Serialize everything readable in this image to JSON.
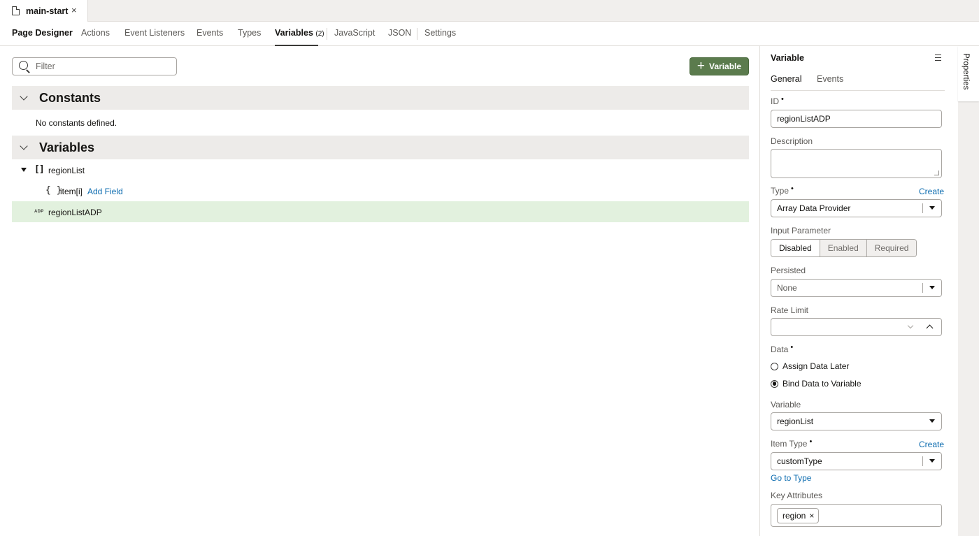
{
  "file_tab": {
    "name": "main-start",
    "close": "×",
    "icon": "document-icon"
  },
  "tabs": [
    {
      "label": "Page Designer"
    },
    {
      "label": "Actions"
    },
    {
      "label": "Event Listeners"
    },
    {
      "label": "Events"
    },
    {
      "label": "Types"
    },
    {
      "label": "Variables",
      "count": "(2)",
      "active": true
    },
    {
      "label": "JavaScript"
    },
    {
      "label": "JSON"
    },
    {
      "label": "Settings"
    }
  ],
  "toolbar": {
    "filter_placeholder": "Filter",
    "add_variable_label": "Variable",
    "add_icon": "+"
  },
  "constants": {
    "title": "Constants",
    "empty_text": "No constants defined."
  },
  "variables": {
    "title": "Variables",
    "items": [
      {
        "icon_text": "[]",
        "name": "regionList",
        "expanded": true
      },
      {
        "icon_text": "{ }",
        "name": "item[i]",
        "action": "Add Field"
      },
      {
        "icon_text": "ADP",
        "name": "regionListADP",
        "selected": true
      }
    ]
  },
  "properties_tab_label": "Properties",
  "panel": {
    "title": "Variable",
    "tabs": [
      "General",
      "Events"
    ],
    "active_tab": "General",
    "id_label": "ID",
    "id_value": "regionListADP",
    "description_label": "Description",
    "description_value": "",
    "type_label": "Type",
    "type_create": "Create",
    "type_value": "Array Data Provider",
    "input_parameter_label": "Input Parameter",
    "input_parameter_options": [
      "Disabled",
      "Enabled",
      "Required"
    ],
    "input_parameter_selected": "Disabled",
    "persisted_label": "Persisted",
    "persisted_value": "None",
    "rate_limit_label": "Rate Limit",
    "rate_limit_value": "",
    "data_label": "Data",
    "data_options": [
      "Assign Data Later",
      "Bind Data to Variable"
    ],
    "data_selected": "Bind Data to Variable",
    "variable_label": "Variable",
    "variable_value": "regionList",
    "item_type_label": "Item Type",
    "item_type_create": "Create",
    "item_type_value": "customType",
    "go_to_type": "Go to Type",
    "key_attributes_label": "Key Attributes",
    "key_attributes": [
      "region"
    ],
    "required_marker": "•",
    "chip_remove": "×"
  },
  "colors": {
    "accent_green": "#5b7b4d",
    "selected_row": "#e2f1de",
    "link": "#0b6baf",
    "section_bg": "#edebe9"
  }
}
